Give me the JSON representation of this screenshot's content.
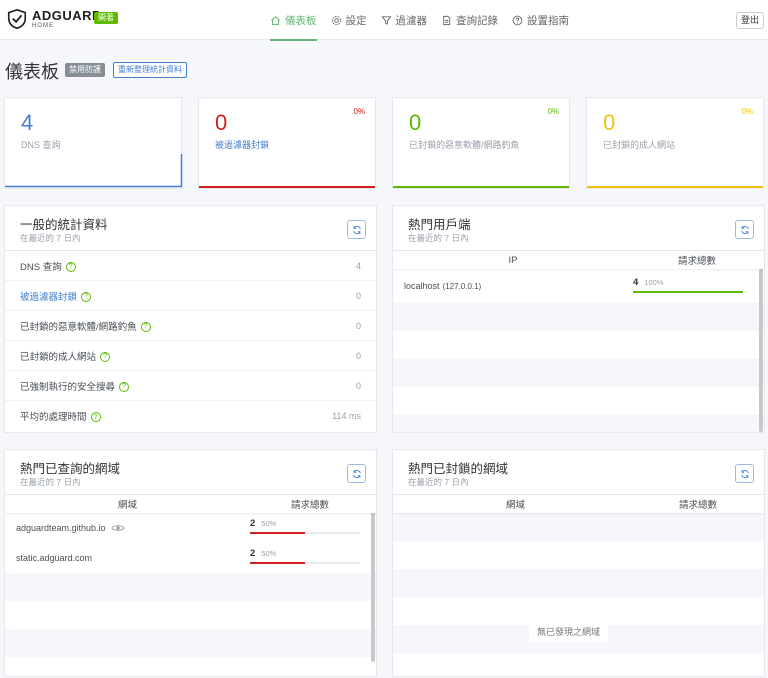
{
  "header": {
    "logo_main": "ADGUARD",
    "logo_sub": "HOME",
    "status_badge": "開著",
    "nav": [
      {
        "label": "儀表板",
        "icon": "home-icon"
      },
      {
        "label": "設定",
        "icon": "gear-icon"
      },
      {
        "label": "過濾器",
        "icon": "filter-icon"
      },
      {
        "label": "查詢記錄",
        "icon": "document-icon"
      },
      {
        "label": "設置指南",
        "icon": "help-circle-icon"
      }
    ],
    "logout": "登出"
  },
  "page": {
    "title": "儀表板",
    "disable_protection": "禁用防護",
    "refresh_stats": "重新整理統計資料"
  },
  "stats": [
    {
      "value": "4",
      "label": "DNS 查詢",
      "pct": "",
      "color": "#467fcf"
    },
    {
      "value": "0",
      "label": "被過濾器封鎖",
      "pct": "0%",
      "color": "#cd201f"
    },
    {
      "value": "0",
      "label": "已封鎖的惡意軟體/網路釣魚",
      "pct": "0%",
      "color": "#5eba00"
    },
    {
      "value": "0",
      "label": "已封鎖的成人網站",
      "pct": "0%",
      "color": "#f1c40f"
    }
  ],
  "general": {
    "title": "一般的統計資料",
    "subtitle": "在最近的 7 日內",
    "rows": [
      {
        "label": "DNS 查詢",
        "value": "4"
      },
      {
        "label": "被過濾器封鎖",
        "value": "0"
      },
      {
        "label": "已封鎖的惡意軟體/網路釣魚",
        "value": "0"
      },
      {
        "label": "已封鎖的成人網站",
        "value": "0"
      },
      {
        "label": "已強制執行的安全搜尋",
        "value": "0"
      },
      {
        "label": "平均的處理時間",
        "value": "114 ms"
      }
    ]
  },
  "clients": {
    "title": "熱門用戶端",
    "subtitle": "在最近的 7 日內",
    "col_ip": "IP",
    "col_count": "請求總數",
    "rows": [
      {
        "name": "localhost",
        "ip": "(127.0.0.1)",
        "count": "4",
        "pct": "100%",
        "fraction": 1.0
      }
    ]
  },
  "queried": {
    "title": "熱門已查詢的網域",
    "subtitle": "在最近的 7 日內",
    "col_domain": "網域",
    "col_count": "請求總數",
    "rows": [
      {
        "domain": "adguardteam.github.io",
        "count": "2",
        "pct": "50%",
        "fraction": 0.5
      },
      {
        "domain": "static.adguard.com",
        "count": "2",
        "pct": "50%",
        "fraction": 0.5
      }
    ]
  },
  "blocked": {
    "title": "熱門已封鎖的網域",
    "subtitle": "在最近的 7 日內",
    "col_domain": "網域",
    "col_count": "請求總數",
    "empty": "無已發現之網域"
  }
}
